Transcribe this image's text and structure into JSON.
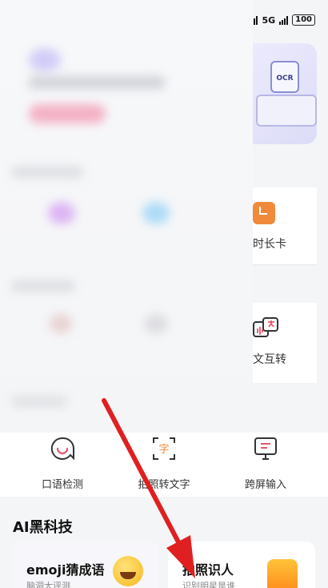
{
  "status_bar": {
    "network": "5G",
    "battery": "100"
  },
  "banner": {
    "image_text": "OCR"
  },
  "right_column": {
    "timer_label": "时长卡",
    "translate_label": "文互转"
  },
  "tools": [
    {
      "label": "口语检测",
      "icon": "speech-check-icon"
    },
    {
      "label": "拍照转文字",
      "icon": "photo-text-icon"
    },
    {
      "label": "跨屏输入",
      "icon": "cross-screen-icon"
    }
  ],
  "ai_section": {
    "title": "AI黑科技",
    "cards": [
      {
        "title": "emoji猜成语",
        "subtitle": "脑洞大评测",
        "icon": "emoji-icon"
      },
      {
        "title": "拍照识人",
        "subtitle": "识别明星是谁",
        "icon": "photo-person-icon"
      }
    ]
  },
  "colors": {
    "accent_orange": "#f08a3a",
    "arrow_red": "#e02020",
    "icon_pink": "#e7546b"
  }
}
